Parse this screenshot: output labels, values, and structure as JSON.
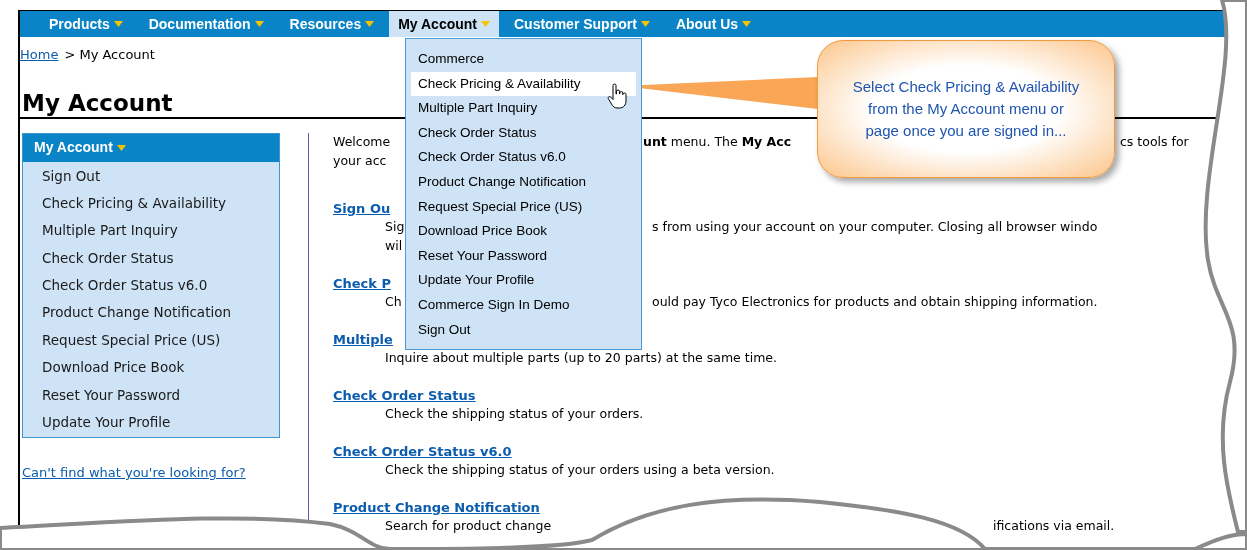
{
  "nav": [
    {
      "label": "Products",
      "selected": false
    },
    {
      "label": "Documentation",
      "selected": false
    },
    {
      "label": "Resources",
      "selected": false
    },
    {
      "label": "My Account",
      "selected": true
    },
    {
      "label": "Customer Support",
      "selected": false
    },
    {
      "label": "About Us",
      "selected": false
    }
  ],
  "breadcrumb": {
    "link": "Home",
    "current": "> My Account"
  },
  "title": "My Account",
  "sidebar": {
    "header": "My Account",
    "items": [
      "Sign Out",
      "Check Pricing & Availability",
      "Multiple Part Inquiry",
      "Check Order Status",
      "Check Order Status v6.0",
      "Product Change Notification",
      "Request Special Price (US)",
      "Download Price Book",
      "Reset Your Password",
      "Update Your Profile"
    ],
    "help_link": "Can't find what you're looking for?"
  },
  "intro": [
    [
      "Welcome",
      "**unt** menu. The **My Acc**",
      "cs tools for"
    ],
    [
      "your acc"
    ]
  ],
  "sections": [
    {
      "title": "Sign Ou",
      "lines": [
        [
          "Sig",
          "s from using your account on your computer. Closing all browser windo"
        ],
        [
          "wil"
        ]
      ]
    },
    {
      "title": "Check P",
      "lines": [
        [
          "Ch",
          "ould pay Tyco Electronics for products and obtain shipping information."
        ]
      ]
    },
    {
      "title": "Multiple",
      "lines": [
        [
          "Inquire about multiple parts (up to 20 parts) at the same time."
        ]
      ]
    },
    {
      "title": "Check Order Status",
      "lines": [
        [
          "Check the shipping status of your orders."
        ]
      ]
    },
    {
      "title": "Check Order Status v6.0",
      "lines": [
        [
          "Check the shipping status of your orders using a beta version."
        ]
      ]
    },
    {
      "title": "Product Change Notification",
      "lines": [
        [
          "Search for product change",
          "ifications via email."
        ]
      ]
    }
  ],
  "dropdown": [
    {
      "label": "Commerce",
      "selected": false
    },
    {
      "label": "Check Pricing & Availability",
      "selected": true
    },
    {
      "label": "Multiple Part Inquiry",
      "selected": false
    },
    {
      "label": "Check Order Status",
      "selected": false
    },
    {
      "label": "Check Order Status v6.0",
      "selected": false
    },
    {
      "label": "Product Change Notification",
      "selected": false
    },
    {
      "label": "Request Special Price (US)",
      "selected": false
    },
    {
      "label": "Download Price Book",
      "selected": false
    },
    {
      "label": "Reset Your Password",
      "selected": false
    },
    {
      "label": "Update Your Profile",
      "selected": false
    },
    {
      "label": "Commerce Sign In Demo",
      "selected": false
    },
    {
      "label": "Sign Out",
      "selected": false
    }
  ],
  "callout": "Select Check Pricing & Availability from the My Account menu or page once you are signed in..."
}
